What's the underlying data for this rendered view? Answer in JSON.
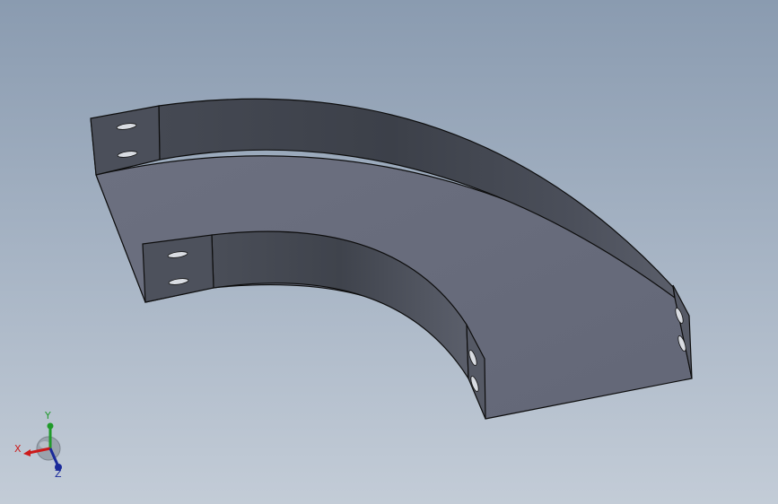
{
  "triad": {
    "x_label": "X",
    "y_label": "Y",
    "z_label": "Z",
    "x_color": "#cc1a1a",
    "y_color": "#1f9a2a",
    "z_color": "#1a2a9a"
  },
  "model": {
    "top_face_color": "#676b7b",
    "wall_color": "#444852",
    "slot_icon": "slot-hole-icon"
  }
}
